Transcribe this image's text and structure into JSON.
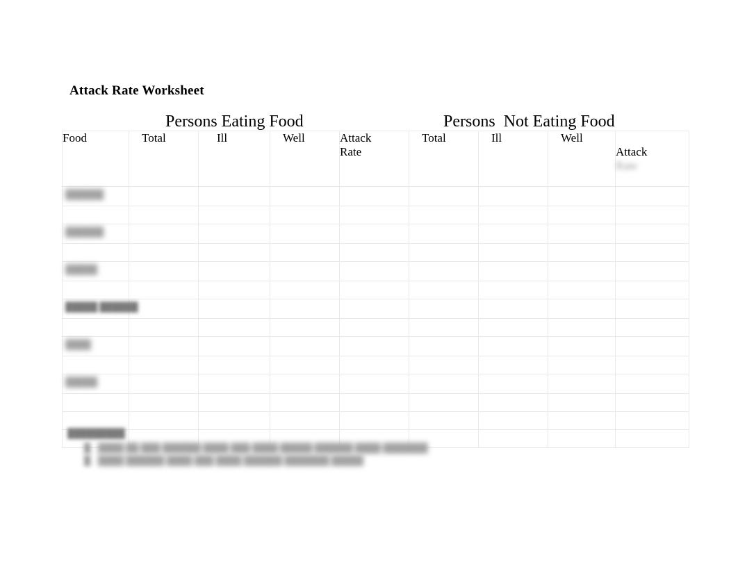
{
  "document": {
    "title": "Attack Rate Worksheet"
  },
  "table": {
    "section_headers": [
      {
        "label": "Persons Eating Food",
        "spans_columns": [
          1,
          2,
          3,
          4,
          5
        ]
      },
      {
        "label": "Persons  Not Eating Food",
        "spans_columns": [
          6,
          7,
          8,
          9
        ]
      }
    ],
    "columns": [
      {
        "key": "food",
        "label": "Food"
      },
      {
        "key": "eat_total",
        "label": "Total"
      },
      {
        "key": "eat_ill",
        "label": "Ill"
      },
      {
        "key": "eat_well",
        "label": "Well"
      },
      {
        "key": "eat_rate",
        "label": "Attack\nRate"
      },
      {
        "key": "noteat_total",
        "label": "Total"
      },
      {
        "key": "noteat_ill",
        "label": "Ill"
      },
      {
        "key": "noteat_well",
        "label": "Well"
      },
      {
        "key": "noteat_rate",
        "label": "Attack"
      }
    ],
    "noteat_rate_second_line": "Rate",
    "rows": [
      {
        "food_label": "██████",
        "blurred": true
      },
      {
        "food_label": "",
        "blurred": false
      },
      {
        "food_label": "██████",
        "blurred": true
      },
      {
        "food_label": "",
        "blurred": false
      },
      {
        "food_label": "█████",
        "blurred": true
      },
      {
        "food_label": "",
        "blurred": false
      },
      {
        "food_label": "█████ ██████",
        "blurred": true
      },
      {
        "food_label": "",
        "blurred": false
      },
      {
        "food_label": "████",
        "blurred": true
      },
      {
        "food_label": "",
        "blurred": false
      },
      {
        "food_label": "█████",
        "blurred": true
      },
      {
        "food_label": "",
        "blurred": false
      },
      {
        "food_label": "",
        "blurred": false
      },
      {
        "food_label": "",
        "blurred": false
      }
    ]
  },
  "footer": {
    "heading": "█████████",
    "items": [
      {
        "marker": "█.",
        "text": "████ ██ ███ ██████ ████ ███ ████ █████ ██████ ████ ███████"
      },
      {
        "marker": "█.",
        "text": "████ ██████ ████ ███ ████ ██████ ███████ █████"
      }
    ]
  },
  "colors": {
    "page_background": "#ffffff",
    "text": "#000000",
    "grid_line": "#e9e9e9",
    "redacted_text": "#8e8e8e"
  }
}
